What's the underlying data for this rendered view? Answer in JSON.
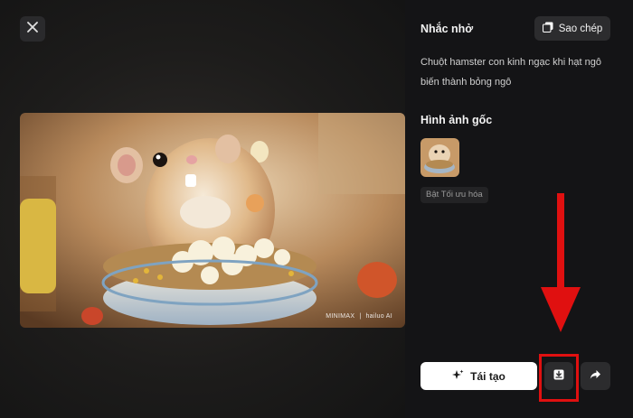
{
  "dialog": {
    "close_icon": "close-icon"
  },
  "hero_image": {
    "description_icon": "generated-image",
    "watermark_left": "MINIMAX",
    "watermark_right": "hailuo AI"
  },
  "sidebar": {
    "prompt_title": "Nhắc nhở",
    "copy_label": "Sao chép",
    "copy_icon": "copy-icon",
    "prompt_text": "Chuột hamster con kinh ngạc khi hạt ngô biến thành bỏng ngô",
    "source_title": "Hình ảnh gốc",
    "optimize_tag": "Bật Tối ưu hóa"
  },
  "actions": {
    "regenerate_label": "Tái tạo",
    "regenerate_icon": "sparkle-icon",
    "download_icon": "download-icon",
    "share_icon": "share-icon"
  },
  "annotation": {
    "color": "#e01010"
  }
}
